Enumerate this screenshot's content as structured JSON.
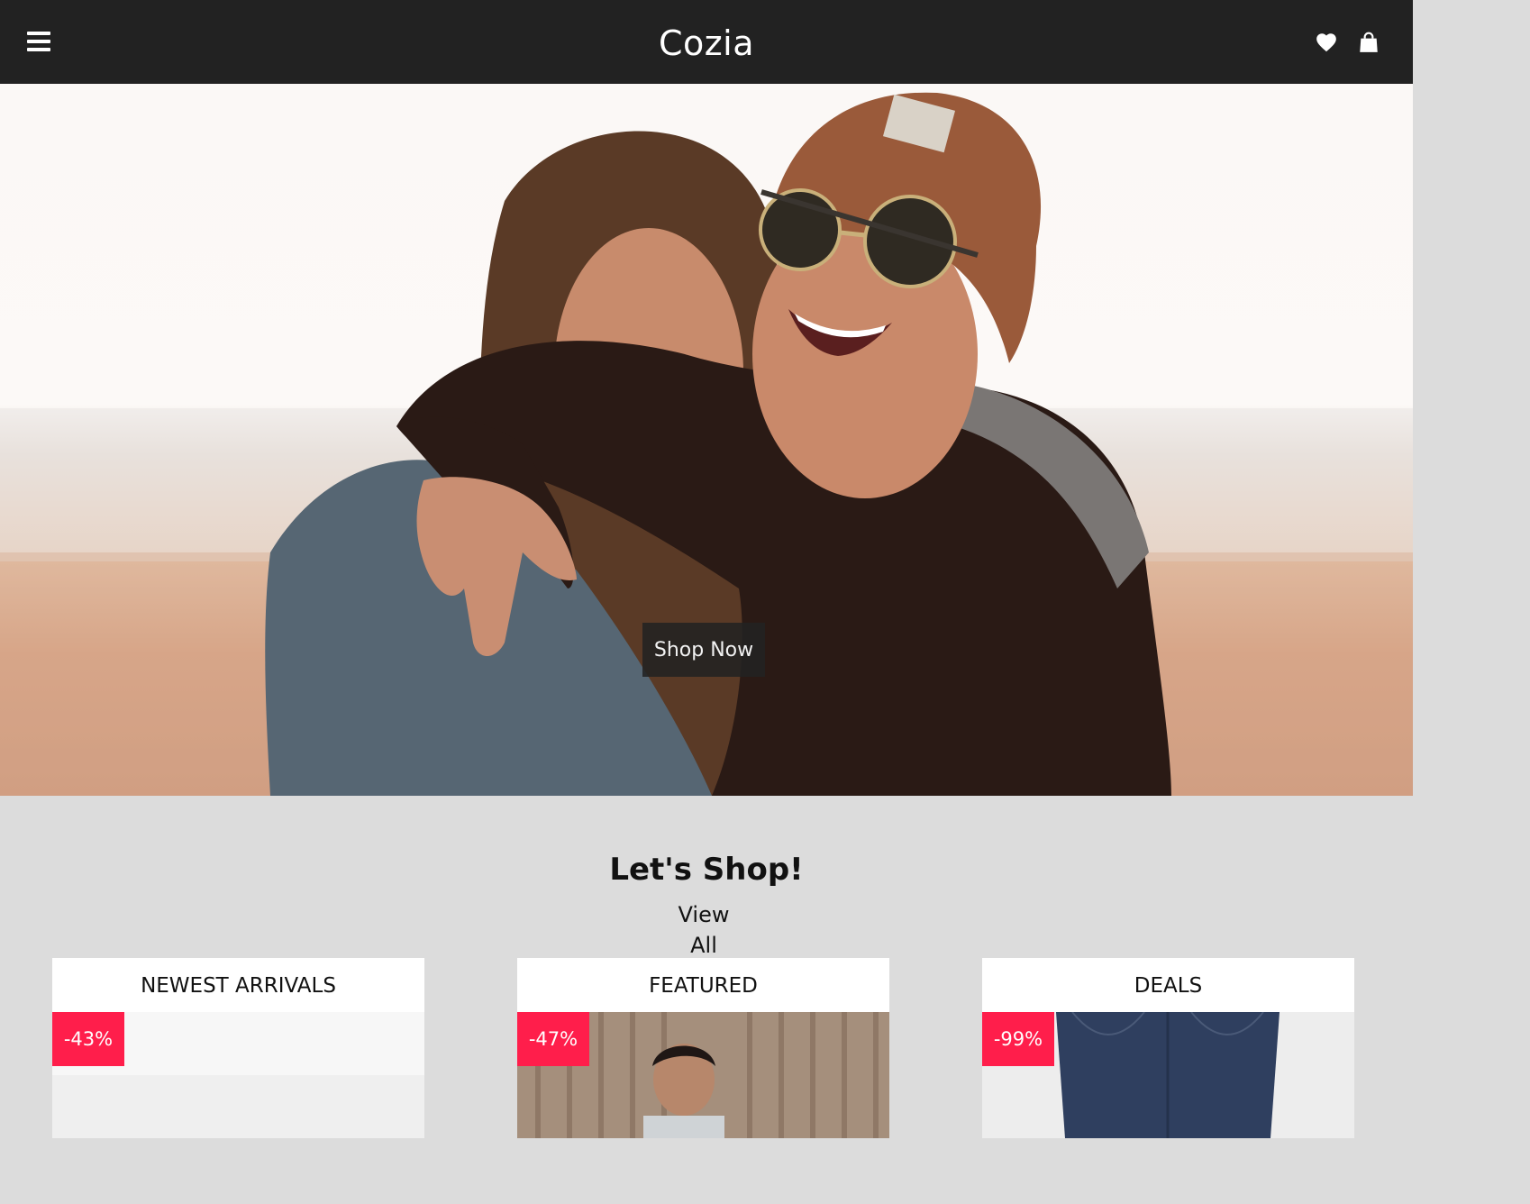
{
  "header": {
    "brand": "Cozia",
    "menu_icon": "hamburger-menu-icon",
    "wishlist_icon": "heart-icon",
    "cart_icon": "shopping-bag-icon"
  },
  "hero": {
    "cta_label": "Shop Now",
    "image": "photo-two-women-hugging-on-beach"
  },
  "shop": {
    "title": "Let's Shop!",
    "view_all": "View All"
  },
  "cards": [
    {
      "title": "NEWEST ARRIVALS",
      "badge": "-43%"
    },
    {
      "title": "FEATURED",
      "badge": "-47%"
    },
    {
      "title": "DEALS",
      "badge": "-99%"
    }
  ],
  "colors": {
    "topbar": "#222222",
    "page_background": "#dcdcdc",
    "badge": "#ff1e4b"
  }
}
